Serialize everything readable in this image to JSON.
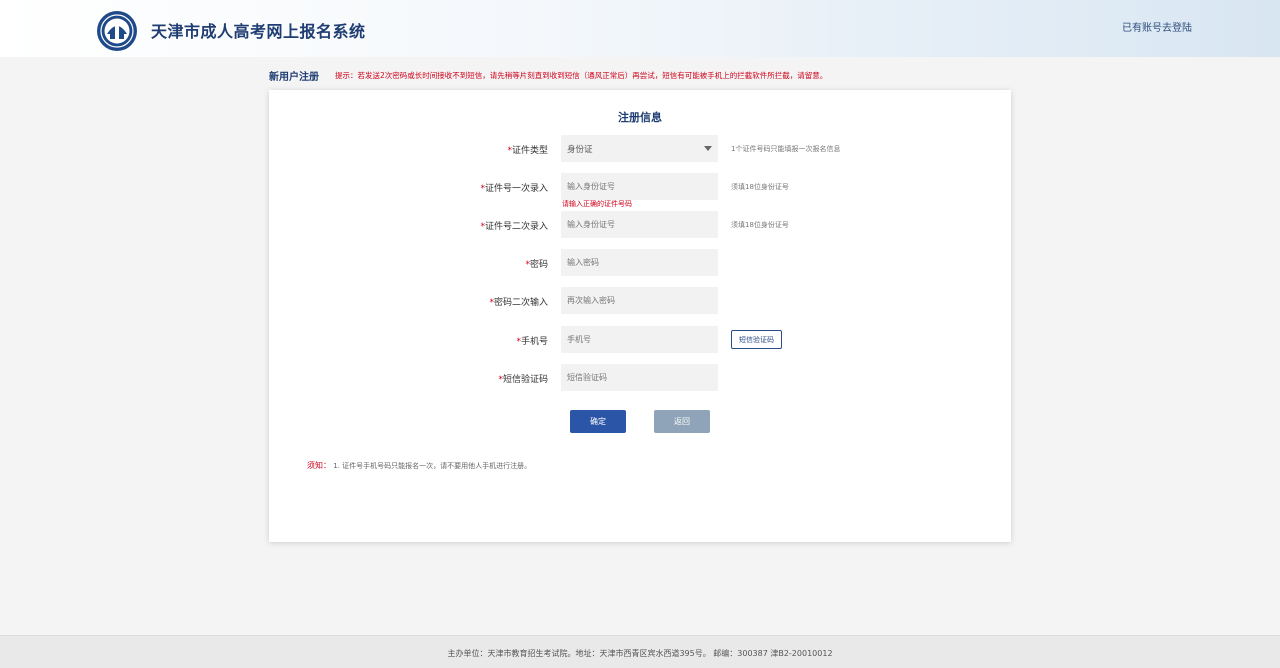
{
  "header": {
    "title": "天津市成人高考网上报名系统",
    "login_link": "已有账号去登陆"
  },
  "subbar": {
    "title": "新用户注册",
    "tip": "提示：若发送2次密码或长时间接收不到短信，请先稍等片刻直到收到短信（通风正常后）再尝试，短信有可能被手机上的拦截软件所拦截，请留意。"
  },
  "form": {
    "title": "注册信息",
    "required_mark": "*",
    "id_type": {
      "label": "证件类型",
      "value": "身份证",
      "hint": "1个证件号码只能填报一次报名信息"
    },
    "id_first": {
      "label": "证件号一次录入",
      "placeholder": "输入身份证号",
      "hint": "须填18位身份证号",
      "error": "请输入正确的证件号码"
    },
    "id_second": {
      "label": "证件号二次录入",
      "placeholder": "输入身份证号",
      "hint": "须填18位身份证号"
    },
    "password": {
      "label": "密码",
      "placeholder": "输入密码"
    },
    "password_confirm": {
      "label": "密码二次输入",
      "placeholder": "再次输入密码"
    },
    "phone": {
      "label": "手机号",
      "placeholder": "手机号",
      "sms_button": "短信验证码"
    },
    "sms_code": {
      "label": "短信验证码",
      "placeholder": "短信验证码"
    },
    "confirm_button": "确定",
    "back_button": "返回"
  },
  "notice": {
    "label": "须知：",
    "text": "1. 证件号手机号码只能报名一次，请不要用他人手机进行注册。"
  },
  "footer": {
    "text": "主办单位：天津市教育招生考试院。地址：天津市西青区宾水西道395号。 邮编：300387 津B2-20010012"
  },
  "colors": {
    "brand": "#1f3d73",
    "primary_button": "#2b56a7",
    "secondary_button": "#8fa4b8",
    "error": "#d0021b"
  }
}
